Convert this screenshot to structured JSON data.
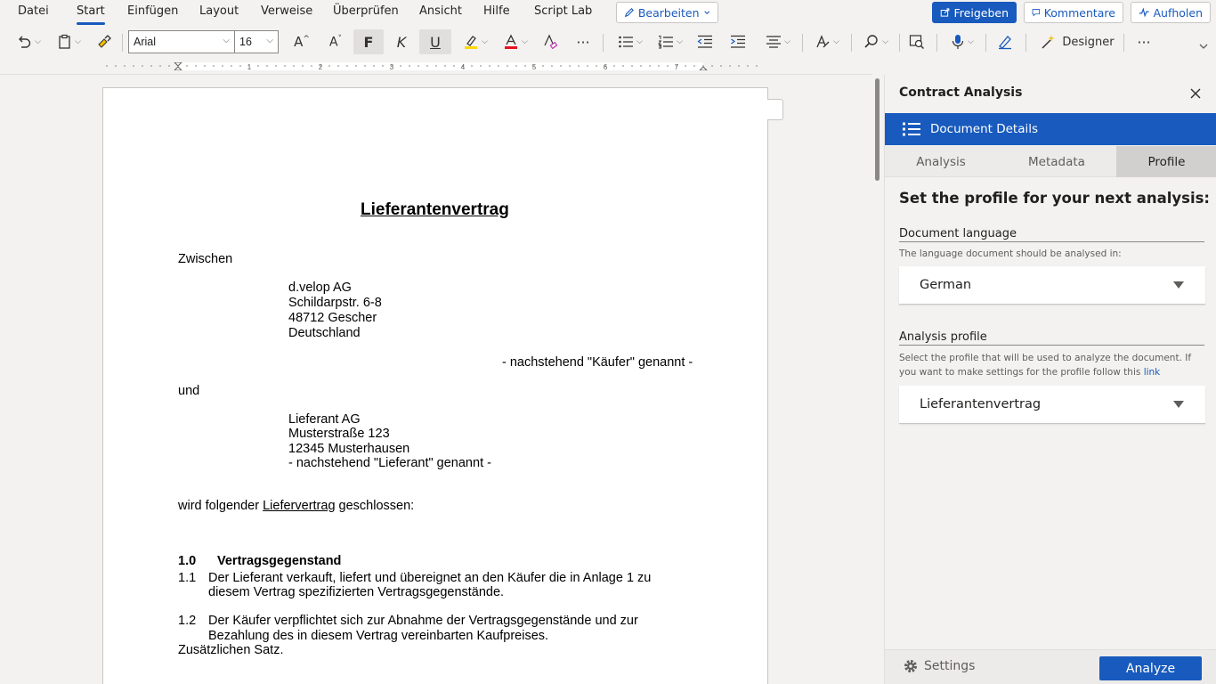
{
  "menu": {
    "items": [
      "Datei",
      "Start",
      "Einfügen",
      "Layout",
      "Verweise",
      "Überprüfen",
      "Ansicht",
      "Hilfe",
      "Script Lab"
    ],
    "active": "Start",
    "edit_label": "Bearbeiten",
    "share_label": "Freigeben",
    "comments_label": "Kommentare",
    "catchup_label": "Aufholen"
  },
  "toolbar": {
    "font_name": "Arial",
    "font_size": "16",
    "bold_glyph": "F",
    "italic_glyph": "K",
    "underline_glyph": "U",
    "designer_label": "Designer",
    "grow_font": "A^",
    "shrink_font": "A˅"
  },
  "ruler": {
    "numbers": [
      "1",
      "2",
      "3",
      "4",
      "5",
      "6",
      "7"
    ]
  },
  "document": {
    "title": "Lieferantenvertrag",
    "between": "Zwischen",
    "party1": [
      "d.velop AG",
      "Schildarpstr. 6-8",
      "48712 Gescher",
      "Deutschland"
    ],
    "party1_role": "- nachstehend \"Käufer\" genannt -",
    "and": "und",
    "party2": [
      "Lieferant AG",
      "Musterstraße 123",
      "12345 Musterhausen",
      "- nachstehend \"Lieferant\" genannt -"
    ],
    "concluded_pre": "wird folgender ",
    "concluded_link": "Liefervertrag",
    "concluded_post": " geschlossen:",
    "section_num": "1.0",
    "section_title": "Vertragsgegenstand",
    "p11_num": "1.1",
    "p11_line1": "Der Lieferant verkauft, liefert und übereignet an den Käufer die in Anlage 1 zu",
    "p11_line2": "diesem Vertrag spezifizierten Vertragsgegenstände.",
    "p12_num": "1.2",
    "p12_line1": "Der Käufer verpflichtet sich zur Abnahme der Vertragsgegenstände und zur",
    "p12_line2": "Bezahlung des in diesem Vertrag vereinbarten Kaufpreises.",
    "extra": "Zusätzlichen Satz."
  },
  "panel": {
    "title": "Contract Analysis",
    "section_label": "Document Details",
    "tabs": [
      "Analysis",
      "Metadata",
      "Profile"
    ],
    "active_tab": "Profile",
    "heading": "Set the profile for your next analysis:",
    "language_label": "Document language",
    "language_help": "The language document should be analysed in:",
    "language_value": "German",
    "profile_label": "Analysis profile",
    "profile_help": "Select the profile that will be used to analyze the document. If you want to make settings for the profile follow this",
    "profile_link": "link",
    "profile_value": "Lieferantenvertrag",
    "settings_label": "Settings",
    "analyze_label": "Analyze"
  },
  "colors": {
    "accent": "#185abd",
    "background": "#f3f2f1",
    "highlight": "#ffd800",
    "font_color": "#e81123"
  }
}
